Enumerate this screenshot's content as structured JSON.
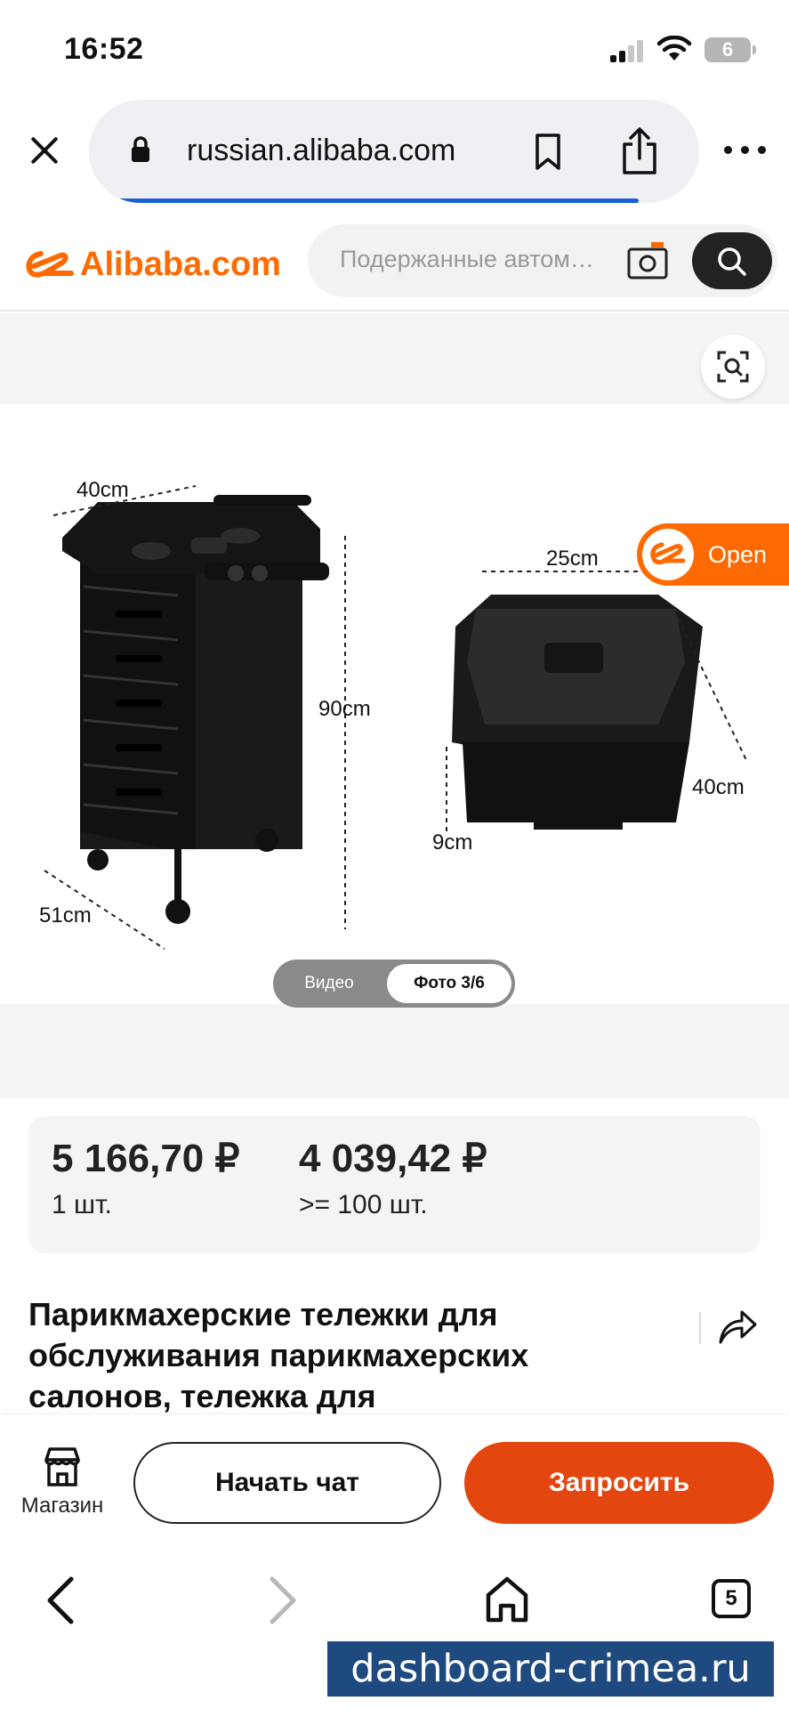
{
  "status_bar": {
    "time": "16:52",
    "battery": "6"
  },
  "browser": {
    "url": "russian.alibaba.com",
    "tab_count": "5"
  },
  "header": {
    "logo_text": "Alibaba.com",
    "search_placeholder": "Подержанные автом…"
  },
  "gallery": {
    "video_label": "Видео",
    "photo_label": "Фото 3/6",
    "open_label": "Open",
    "dimensions": {
      "cart_width": "40cm",
      "cart_height": "90cm",
      "cart_depth": "51cm",
      "drawer_width": "25cm",
      "drawer_depth": "40cm",
      "drawer_height": "9cm"
    }
  },
  "price": {
    "tiers": [
      {
        "price": "5 166,70 ₽",
        "quantity": "1 шт."
      },
      {
        "price": "4 039,42 ₽",
        "quantity": ">= 100 шт."
      }
    ]
  },
  "product": {
    "title": "Парикмахерские тележки для обслуживания парикмахерских салонов, тележка для"
  },
  "actions": {
    "store_label": "Магазин",
    "chat_label": "Начать чат",
    "inquire_label": "Запросить"
  },
  "watermark": "dashboard-crimea.ru",
  "colors": {
    "brand_orange": "#ff6a00",
    "inquire_button": "#e3460f",
    "progress_blue": "#1a5fd6"
  }
}
